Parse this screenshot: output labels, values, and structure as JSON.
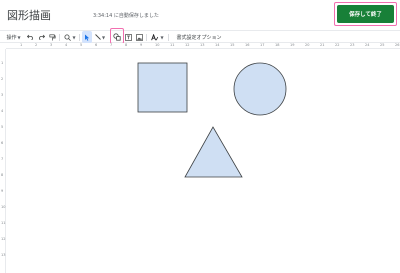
{
  "header": {
    "title": "図形描画",
    "saved_status": "3:34:14 に自動保存しました",
    "save_button_label": "保存して終了"
  },
  "toolbar": {
    "actions_label": "操作",
    "format_options_label": "書式設定オプション",
    "active_color": "#d3e3fd",
    "icons": [
      "undo-icon",
      "redo-icon",
      "paint-format-icon",
      "zoom-icon",
      "select-icon",
      "line-icon",
      "shape-icon",
      "textbox-icon",
      "image-icon",
      "word-art-icon"
    ]
  },
  "ruler": {
    "top_ticks": [
      "1",
      "2",
      "3",
      "4",
      "5",
      "6",
      "7",
      "8",
      "9",
      "10",
      "11",
      "12",
      "13",
      "14",
      "15",
      "16",
      "17",
      "18",
      "19",
      "20",
      "21",
      "22",
      "23",
      "24",
      "25",
      "26"
    ],
    "left_ticks": [
      "1",
      "2",
      "3",
      "4",
      "5",
      "6",
      "7",
      "8",
      "9",
      "10",
      "11",
      "12",
      "13"
    ]
  },
  "canvas": {
    "shapes": [
      "square",
      "circle",
      "triangle"
    ],
    "fill": "#cfdff3",
    "stroke": "#3c4043"
  },
  "colors": {
    "save_button": "#188038",
    "highlight": "#f26fb0"
  }
}
